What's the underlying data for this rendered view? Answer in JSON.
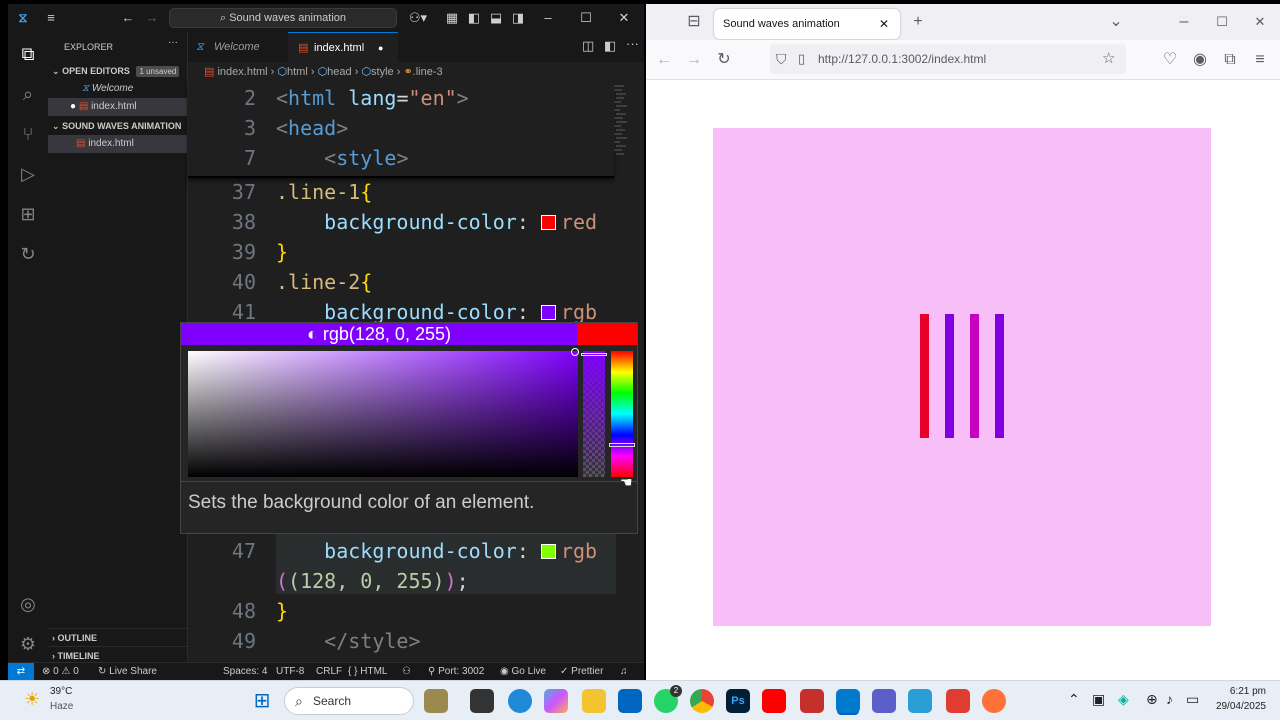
{
  "vscode": {
    "command_center": "Sound waves animation",
    "sidebar": {
      "title": "EXPLORER",
      "open_editors": "OPEN EDITORS",
      "unsaved_badge": "1 unsaved",
      "open_items": [
        "Welcome",
        "index.html"
      ],
      "folder": "SOUND WAVES ANIMATION",
      "folder_items": [
        "index.html"
      ],
      "outline": "OUTLINE",
      "timeline": "TIMELINE"
    },
    "tabs": [
      "Welcome",
      "index.html"
    ],
    "breadcrumb": [
      "index.html",
      "html",
      "head",
      "style",
      ".line-3"
    ],
    "sticky_lines": [
      {
        "n": "2",
        "t1": "<",
        "t2": "html",
        "t3": " lang",
        "t4": "=",
        "t5": "\"en\"",
        "t6": ">"
      },
      {
        "n": "3",
        "t1": "<",
        "t2": "head",
        "t3": ">"
      },
      {
        "n": "7",
        "t1": "<",
        "t2": "style",
        "t3": ">"
      }
    ],
    "lines": {
      "l37_n": "37",
      "l37": ".line-1",
      "l38_n": "38",
      "l38_p": "background-color",
      "l38_v": "red",
      "l39_n": "39",
      "l40_n": "40",
      "l40": ".line-2",
      "l41_n": "41",
      "l41_p": "background-color",
      "l41_v": "rgb",
      "l47_n": "47",
      "l47_p": "background-color",
      "l47_v": "rgb",
      "l47b": "(128, 0, 255)",
      "l48_n": "48",
      "l49_n": "49",
      "l49": "</style>"
    },
    "picker": {
      "value": "rgb(128, 0, 255)",
      "current_color": "#8000ff",
      "original_color": "#ff0000"
    },
    "hover_text": "Sets the background color of an element.",
    "status": {
      "problems": "⊗ 0 ⚠ 0",
      "live_share": "Live Share",
      "spaces": "Spaces: 4",
      "encoding": "UTF-8",
      "eol": "CRLF",
      "language": "{ } HTML",
      "port": "Port: 3002",
      "go_live": "Go Live",
      "prettier": "Prettier"
    }
  },
  "browser": {
    "tab_title": "Sound waves animation",
    "url": "http://127.0.0.1:3002/index.html",
    "stage_color": "#f8bef8",
    "waves": [
      "#e8002a",
      "#8000e0",
      "#c800c0",
      "#8000e0"
    ]
  },
  "taskbar": {
    "temperature": "39°C",
    "weather": "Haze",
    "search": "Search",
    "time": "6:21 pm",
    "date": "29/04/2025",
    "badge": "2"
  }
}
